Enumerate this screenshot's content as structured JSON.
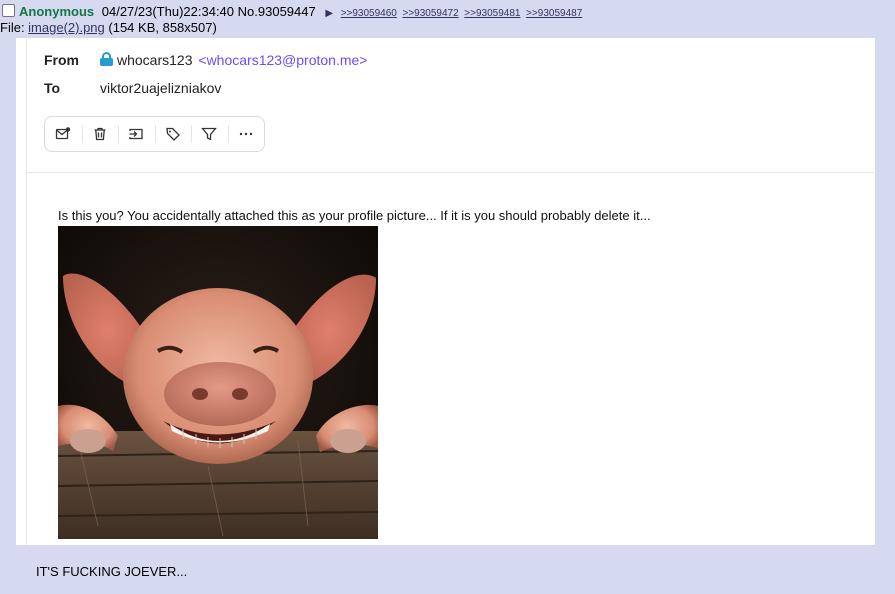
{
  "post": {
    "name": "Anonymous",
    "datetime": "04/27/23(Thu)22:34:40",
    "number": "No.93059447",
    "arrow": "▶",
    "replies": [
      ">>93059460",
      ">>93059472",
      ">>93059481",
      ">>93059487"
    ],
    "file_prefix": "File: ",
    "file_name": "image(2).png",
    "file_meta": " (154 KB, 858x507)",
    "comment": "IT'S FUCKING JOEVER..."
  },
  "email": {
    "from_label": "From",
    "to_label": "To",
    "sender_name": "whocars123",
    "sender_email": "<whocars123@proton.me>",
    "recipient": "viktor2uajelizniakov",
    "toolbar_icons": [
      "mark-unread-icon",
      "trash-icon",
      "move-icon",
      "tag-icon",
      "filter-icon",
      "more-icon"
    ],
    "body_text": "Is this you? You accidentally attached this as your profile picture... If it is you should probably delete it..."
  },
  "colors": {
    "board_bg": "#d6daf0",
    "name_green": "#117743",
    "link": "#34345c",
    "proton_purple": "#6d4aff",
    "lock_blue": "#239ece"
  }
}
